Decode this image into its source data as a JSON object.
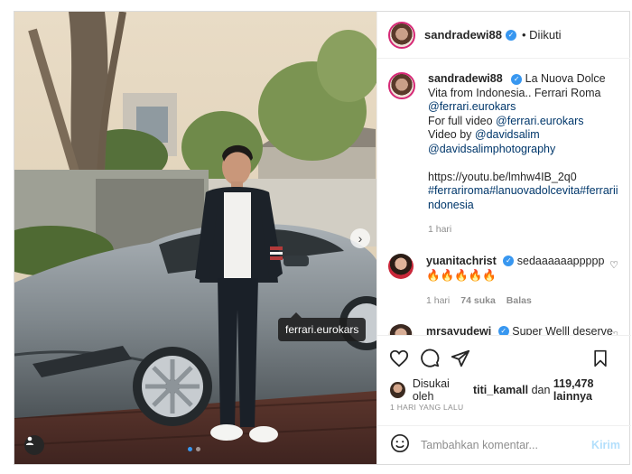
{
  "post": {
    "username": "sandradewi88",
    "follow_status": "Diikuti",
    "photo_tag": "ferrari.eurokars",
    "caption": {
      "text_1": "La Nuova Dolce Vita from Indonesia.. Ferrari Roma",
      "mention_1": "@ferrari.eurokars",
      "line_video": "For full video",
      "mention_2": "@ferrari.eurokars",
      "line_by": "Video by",
      "mention_3": "@davidsalim",
      "mention_4": "@davidsalimphotography",
      "url": "https://youtu.be/lmhw4IB_2q0",
      "hashtags": "#ferrariroma#lanuovadolcevita#ferrariindonesia",
      "time": "1 hari"
    },
    "comments": [
      {
        "username": "yuanitachrist",
        "text": "sedaaaaaappppp",
        "emojis": "🔥🔥🔥🔥🔥",
        "time": "1 hari",
        "likes": "74 suka",
        "reply": "Balas"
      },
      {
        "username": "mrsayudewi",
        "text": "Super Welll deserve"
      }
    ],
    "likes": {
      "prefix": "Disukai oleh",
      "user": "titi_kamall",
      "connector": "dan",
      "count": "119,478 lainnya"
    },
    "date": "1 HARI YANG LALU",
    "composer": {
      "placeholder": "Tambahkan komentar...",
      "post_label": "Kirim"
    }
  },
  "icons": {
    "verified": "verified-badge-icon",
    "like": "heart-icon",
    "comment": "comment-icon",
    "share": "send-icon",
    "save": "bookmark-icon",
    "emoji": "emoji-icon",
    "user_tag": "user-tag-icon"
  },
  "colors": {
    "verified": "#3897f0",
    "link": "#00376b",
    "muted": "#8e8e8e",
    "post_button": "#b2dffc"
  }
}
